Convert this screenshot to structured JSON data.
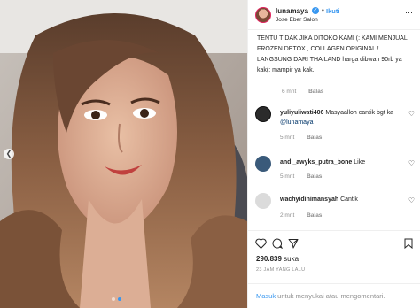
{
  "post": {
    "username": "lunamaya",
    "follow_label": "Ikuti",
    "separator": "•",
    "location": "Jose Eber Salon",
    "more_icon": "more-dots-icon"
  },
  "caption": {
    "text": "TENTU TIDAK JIKA DITOKO KAMI (: KAMI MENJUAL FROZEN DETOX , COLLAGEN ORIGINAL ! LANGSUNG DARI THAILAND harga dibwah 90rb ya kak(: mampir ya kak.",
    "time": "6 mnt",
    "reply_label": "Balas"
  },
  "comments": [
    {
      "username": "yuliyuliwati406",
      "text": "Masyaalloh cantik bgt ka ",
      "mention": "@lunamaya",
      "time": "5 mnt",
      "reply_label": "Balas",
      "avatar_color": "#2b2b2b"
    },
    {
      "username": "andi_awyks_putra_bone",
      "text": "Like",
      "mention": "",
      "time": "5 mnt",
      "reply_label": "Balas",
      "avatar_color": "#3a5a7a"
    },
    {
      "username": "wachyidinimansyah",
      "text": "Cantik",
      "mention": "",
      "time": "2 mnt",
      "reply_label": "Balas",
      "avatar_color": "#dbdbdb"
    }
  ],
  "actions": {
    "likes_count": "290.839",
    "likes_label": "suka",
    "time_ago": "23 JAM YANG LALU"
  },
  "login": {
    "link_label": "Masuk",
    "rest_text": " untuk menyukai atau mengomentari."
  },
  "colors": {
    "accent": "#3897f0",
    "text": "#262626",
    "muted": "#8e8e8e",
    "border": "#efefef"
  }
}
